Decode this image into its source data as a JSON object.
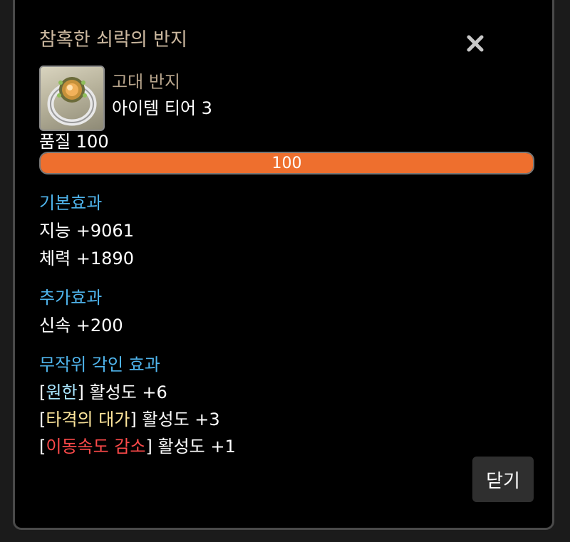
{
  "item": {
    "name": "참혹한 쇠락의 반지",
    "type": "고대 반지",
    "tier": "아이템 티어 3",
    "icon": "ring-icon"
  },
  "quality": {
    "label": "품질 100",
    "value": 100,
    "bar_text": "100",
    "color": "#ee6f2e"
  },
  "basic_effect": {
    "heading": "기본효과",
    "lines": [
      "지능 +9061",
      "체력 +1890"
    ]
  },
  "extra_effect": {
    "heading": "추가효과",
    "lines": [
      "신속 +200"
    ]
  },
  "random_engraving": {
    "heading": "무작위 각인 효과",
    "items": [
      {
        "open": "[",
        "name": "원한",
        "close": "]",
        "suffix": " 활성도 +6",
        "color": "#a9e6ff"
      },
      {
        "open": "[",
        "name": "타격의 대가",
        "close": "]",
        "suffix": " 활성도 +3",
        "color": "#ffe79c"
      },
      {
        "open": "[",
        "name": "이동속도 감소",
        "close": "]",
        "suffix": " 활성도 +1",
        "color": "#ff4a4a"
      }
    ]
  },
  "buttons": {
    "close_icon": "close-icon",
    "close_label": "닫기"
  }
}
